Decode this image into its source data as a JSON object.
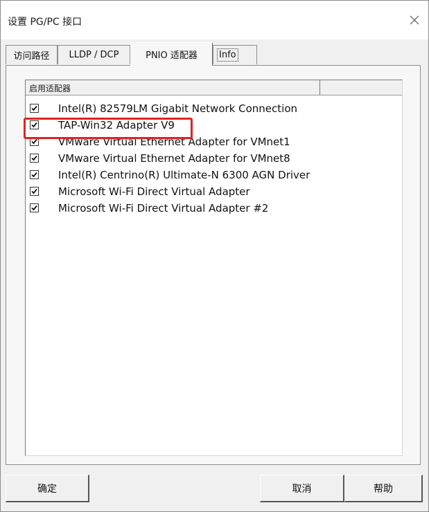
{
  "window": {
    "title": "设置 PG/PC 接口"
  },
  "tabs": [
    {
      "label": "访问路径"
    },
    {
      "label": "LLDP / DCP"
    },
    {
      "label": "PNIO 适配器",
      "active": true
    },
    {
      "label": "Info"
    }
  ],
  "adapter_list": {
    "header": "启用适配器",
    "items": [
      {
        "label": "Intel(R) 82579LM Gigabit Network Connection",
        "checked": true
      },
      {
        "label": "TAP-Win32 Adapter V9",
        "checked": true,
        "highlighted": true
      },
      {
        "label": "VMware Virtual Ethernet Adapter for VMnet1",
        "checked": true
      },
      {
        "label": "VMware Virtual Ethernet Adapter for VMnet8",
        "checked": true
      },
      {
        "label": "Intel(R) Centrino(R) Ultimate-N 6300 AGN Driver",
        "checked": true
      },
      {
        "label": "Microsoft Wi-Fi Direct Virtual Adapter",
        "checked": true
      },
      {
        "label": "Microsoft Wi-Fi Direct Virtual Adapter #2",
        "checked": true
      }
    ]
  },
  "buttons": {
    "ok": "确定",
    "cancel": "取消",
    "help": "帮助"
  },
  "colors": {
    "highlight": "#e02222"
  }
}
